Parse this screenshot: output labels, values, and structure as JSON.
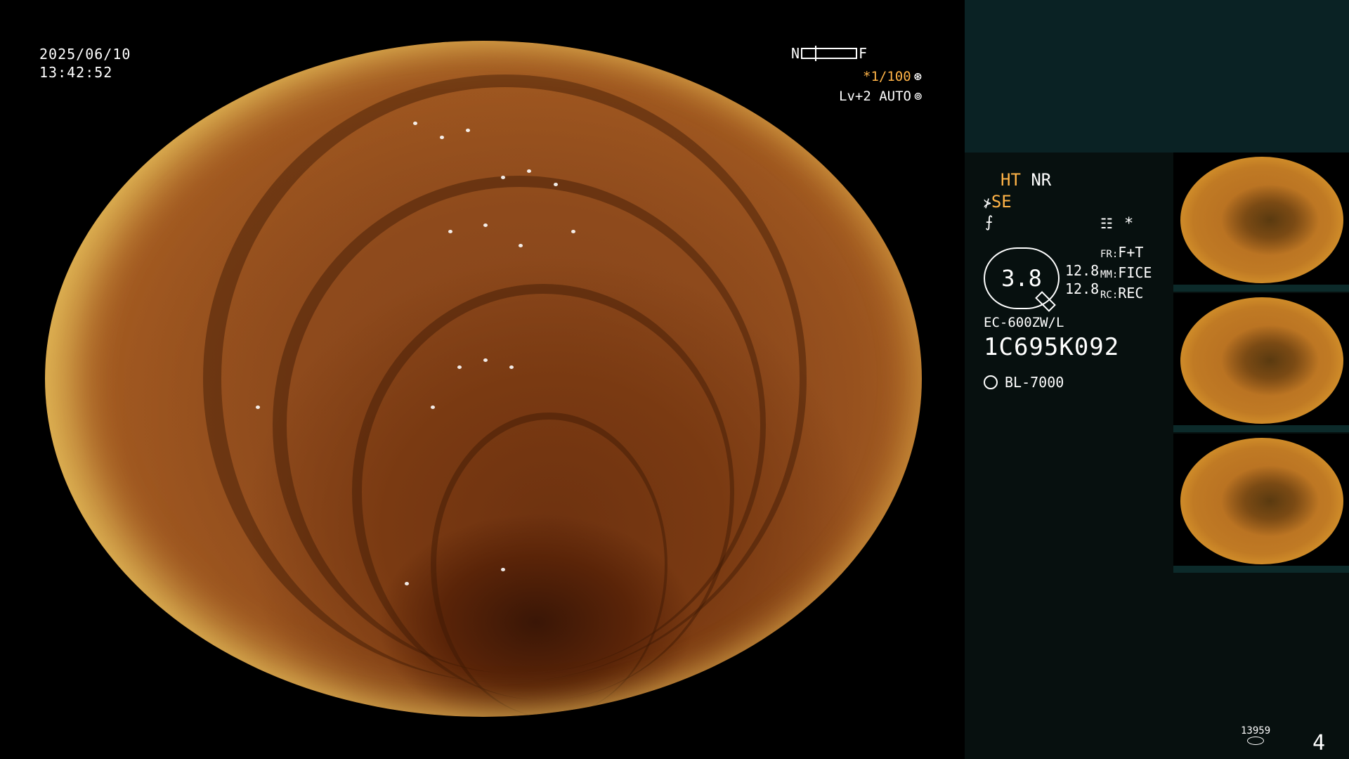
{
  "overlay": {
    "date": "2025/06/10",
    "time": "13:42:52",
    "n_label": "N",
    "f_label": "F",
    "shutter": "*1/100",
    "level": "Lv+2 AUTO"
  },
  "panel": {
    "ht": "HT",
    "nr": "NR",
    "se": "SE",
    "gauge_value": "3.8",
    "num1": "12.8",
    "num2": "12.8",
    "fr_label": "FR:",
    "fr_value": "F+T",
    "mm_label": "MM:",
    "mm_value": "FICE",
    "rc_label": "RC:",
    "rc_value": "REC",
    "model": "EC-600ZW/L",
    "serial": "1C695K092",
    "light_source": "BL-7000",
    "star": "*"
  },
  "thumbnails": [
    {
      "label": "thumbnail-1"
    },
    {
      "label": "thumbnail-2"
    },
    {
      "label": "thumbnail-3"
    }
  ],
  "footer": {
    "image_count": "13959",
    "page_number": "4"
  },
  "colors": {
    "accent": "#ffb347",
    "panel_bg": "#07100f",
    "panel_top_bg": "#0a2224"
  }
}
